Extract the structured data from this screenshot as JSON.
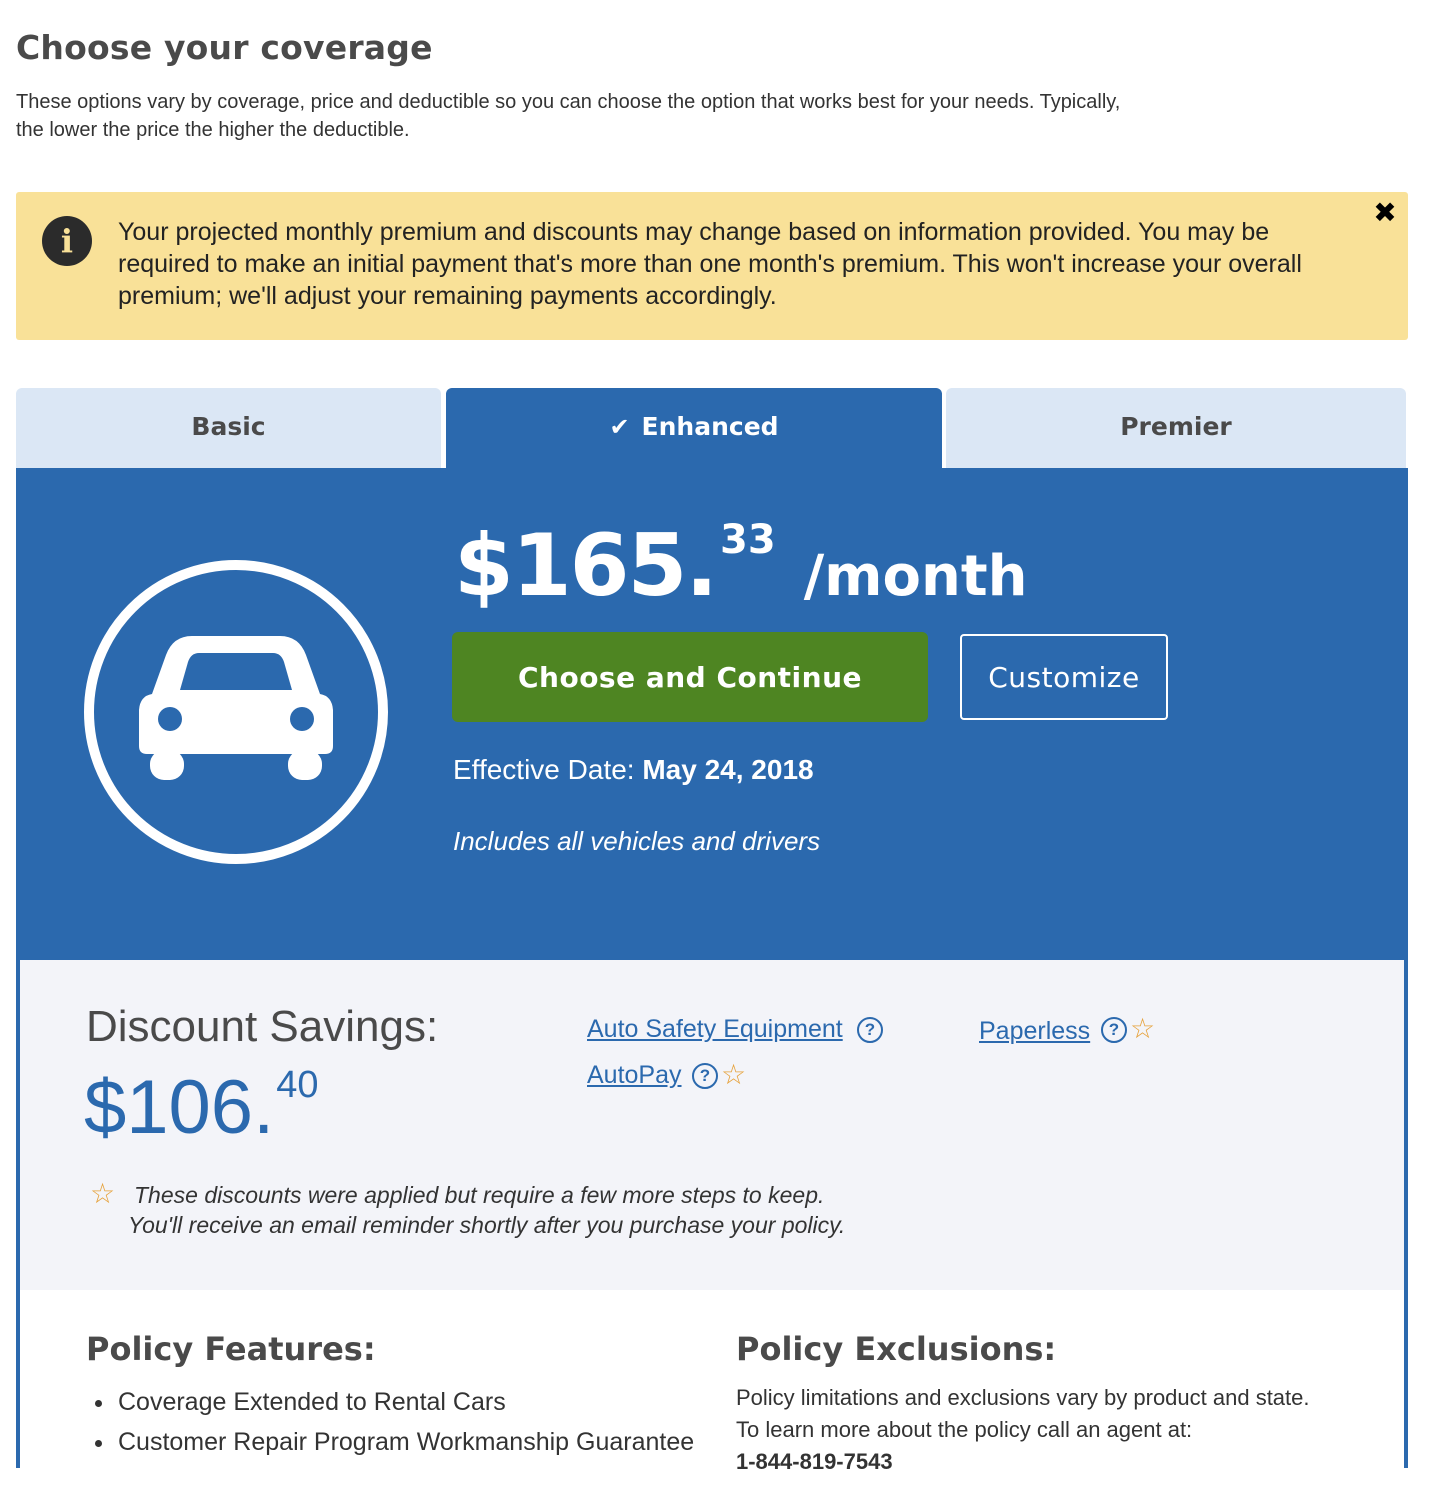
{
  "header": {
    "title": "Choose your coverage",
    "intro_line1": "These options vary by coverage, price and deductible so you can choose the option that works best for your needs. Typically,",
    "intro_line2": "the lower the price the higher the deductible."
  },
  "alert": {
    "icon": "info-icon",
    "message": "Your projected monthly premium and discounts may change based on information provided. You may be required to make an initial payment that's more than one month's premium. This won't increase your overall premium; we'll adjust your remaining payments accordingly.",
    "close_glyph": "✖"
  },
  "tabs": [
    {
      "label": "Basic",
      "selected": false
    },
    {
      "label": "Enhanced",
      "selected": true
    },
    {
      "label": "Premier",
      "selected": false
    }
  ],
  "plan": {
    "icon": "car-icon",
    "price_dollars": "$165.",
    "price_cents": "33",
    "price_period": "/month",
    "choose_label": "Choose and Continue",
    "customize_label": "Customize",
    "effective_label": "Effective Date:",
    "effective_date": "May 24, 2018",
    "includes": "Includes all vehicles and drivers"
  },
  "discounts": {
    "label": "Discount Savings:",
    "amount_dollars": "$106.",
    "amount_cents": "40",
    "items": [
      {
        "label": "Auto Safety Equipment",
        "requires_steps": false
      },
      {
        "label": "AutoPay",
        "requires_steps": true
      },
      {
        "label": "Paperless",
        "requires_steps": true
      }
    ],
    "note_line1": "These discounts were applied but require a few more steps to keep.",
    "note_line2": "You'll receive an email reminder shortly after you purchase your policy."
  },
  "features": {
    "title": "Policy Features:",
    "items": [
      "Coverage Extended to Rental Cars",
      "Customer Repair Program Workmanship Guarantee"
    ]
  },
  "exclusions": {
    "title": "Policy Exclusions:",
    "line1": "Policy limitations and exclusions vary by product and state.",
    "line2": "To learn more about the policy call an agent at:",
    "phone": "1-844-819-7543"
  },
  "colors": {
    "primary_blue": "#2b69ae",
    "tab_inactive": "#dbe7f5",
    "alert_yellow": "#f9e198",
    "cta_green": "#4e8522",
    "star_orange": "#e6a23c"
  }
}
